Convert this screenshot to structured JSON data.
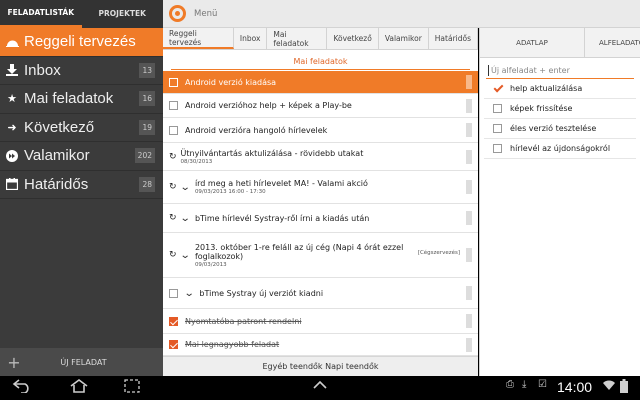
{
  "sidebar": {
    "tabs": [
      "FELADATLISTÁK",
      "PROJEKTEK"
    ],
    "items": [
      {
        "label": "Reggeli tervezés",
        "count": "",
        "icon": "sunrise-icon"
      },
      {
        "label": "Inbox",
        "count": "13",
        "icon": "inbox-icon"
      },
      {
        "label": "Mai feladatok",
        "count": "16",
        "icon": "star-icon"
      },
      {
        "label": "Következő",
        "count": "19",
        "icon": "arrow-right-icon"
      },
      {
        "label": "Valamikor",
        "count": "202",
        "icon": "fast-forward-icon"
      },
      {
        "label": "Határidős",
        "count": "28",
        "icon": "calendar-icon"
      }
    ],
    "new_task_label": "ÚJ FELADAT"
  },
  "header": {
    "menu_label": "Menü"
  },
  "center": {
    "tabs": [
      "Reggeli tervezés",
      "Inbox",
      "Mai feladatok",
      "Következő",
      "Valamikor",
      "Határidős"
    ],
    "section_title": "Mai feladatok",
    "tasks": [
      {
        "title": "Android verzió kiadása",
        "date": "",
        "tag": ""
      },
      {
        "title": "Android verzióhoz help + képek a Play-be",
        "date": "",
        "tag": ""
      },
      {
        "title": "Android verzióra hangoló hírlevelek",
        "date": "",
        "tag": ""
      },
      {
        "title": "Ütnyilvántartás aktulizálása - rövidebb utakat",
        "date": "08/30/2013",
        "tag": ""
      },
      {
        "title": "írd meg a heti hírlevelet MA! - Valami akció",
        "date": "09/03/2013 16:00 - 17:30",
        "tag": ""
      },
      {
        "title": "bTime hírlevél Systray-ről írni a kiadás után",
        "date": "",
        "tag": ""
      },
      {
        "title": "2013. október 1-re feláll az új cég (Napi 4 órát ezzel foglalkozok)",
        "date": "09/03/2013",
        "tag": "[Cégszervezés]"
      },
      {
        "title": "bTime Systray új verziót kiadni",
        "date": "",
        "tag": ""
      },
      {
        "title": "Nyomtatóba patront rendelni",
        "date": "",
        "tag": ""
      },
      {
        "title": "Mai legnagyobb feladat",
        "date": "",
        "tag": ""
      }
    ],
    "footer_text": "Egyéb teendők Napi teendők"
  },
  "right": {
    "tabs": [
      "ADATLAP",
      "ALFELADATOK"
    ],
    "input_placeholder": "Új alfeladat + enter",
    "subtasks": [
      {
        "label": "help aktualizálása",
        "checked": true
      },
      {
        "label": "képek frissítése",
        "checked": false
      },
      {
        "label": "éles verzió tesztelése",
        "checked": false
      },
      {
        "label": "hírlevél az újdonságokról",
        "checked": false
      }
    ]
  },
  "system": {
    "clock": "14:00"
  },
  "colors": {
    "accent": "#f07b28",
    "sidebar_bg": "#3b3b3b"
  }
}
